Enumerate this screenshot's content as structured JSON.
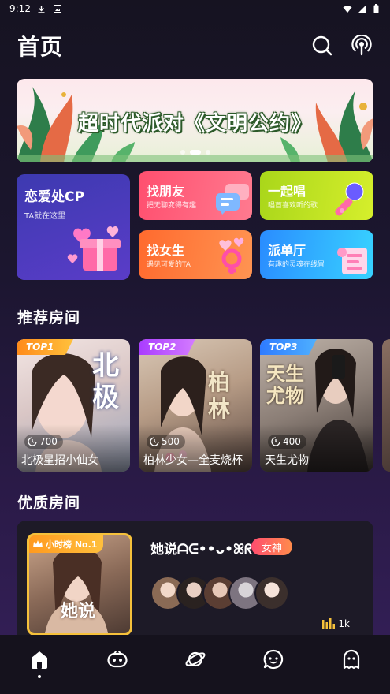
{
  "status_bar": {
    "time": "9:12",
    "icons": [
      "download-icon",
      "notification-icon",
      "wifi-icon",
      "signal-icon",
      "battery-icon"
    ]
  },
  "header": {
    "title": "首页",
    "actions": [
      "search-icon",
      "live-broadcast-icon"
    ]
  },
  "banner": {
    "title": "超时代派对《文明公约》",
    "dots": 3,
    "active_dot": 1
  },
  "categories": [
    {
      "title": "恋爱处CP",
      "subtitle": "TA就在这里",
      "color": "#4b3ab8"
    },
    {
      "title": "找朋友",
      "subtitle": "把无聊变得有趣",
      "color": "#ff5a70"
    },
    {
      "title": "一起唱",
      "subtitle": "唱首喜欢听的歌",
      "color": "#b6de1c"
    },
    {
      "title": "找女生",
      "subtitle": "遇见可爱的TA",
      "color": "#ff7a3c"
    },
    {
      "title": "派单厅",
      "subtitle": "有趣的灵魂在线冒",
      "color": "#2ea6ff"
    }
  ],
  "recommended": {
    "title": "推荐房间",
    "rooms": [
      {
        "badge": "TOP1",
        "count": "700",
        "name": "北极星招小仙女",
        "overlay_text": "北极",
        "badge_color": "#ff9a1f"
      },
      {
        "badge": "TOP2",
        "count": "500",
        "name": "柏林少女—全麦烧杯",
        "overlay_text": "柏林",
        "badge_color": "#b04cff"
      },
      {
        "badge": "TOP3",
        "count": "400",
        "name": "天生尤物",
        "overlay_text": "天生尤物",
        "badge_color": "#2e8bff"
      }
    ]
  },
  "premium": {
    "title": "优质房间",
    "room": {
      "rank_label": "小时榜 No.1",
      "thumb_text": "她说",
      "name": "她说ᗩᕮ••ᴗ•ꕤᖇ",
      "tag": "女神",
      "listeners": "1k"
    }
  },
  "bottom_nav": [
    {
      "icon": "home-icon",
      "active": true
    },
    {
      "icon": "game-controller-icon",
      "active": false
    },
    {
      "icon": "planet-icon",
      "active": false
    },
    {
      "icon": "chat-icon",
      "active": false
    },
    {
      "icon": "ghost-profile-icon",
      "active": false
    }
  ]
}
